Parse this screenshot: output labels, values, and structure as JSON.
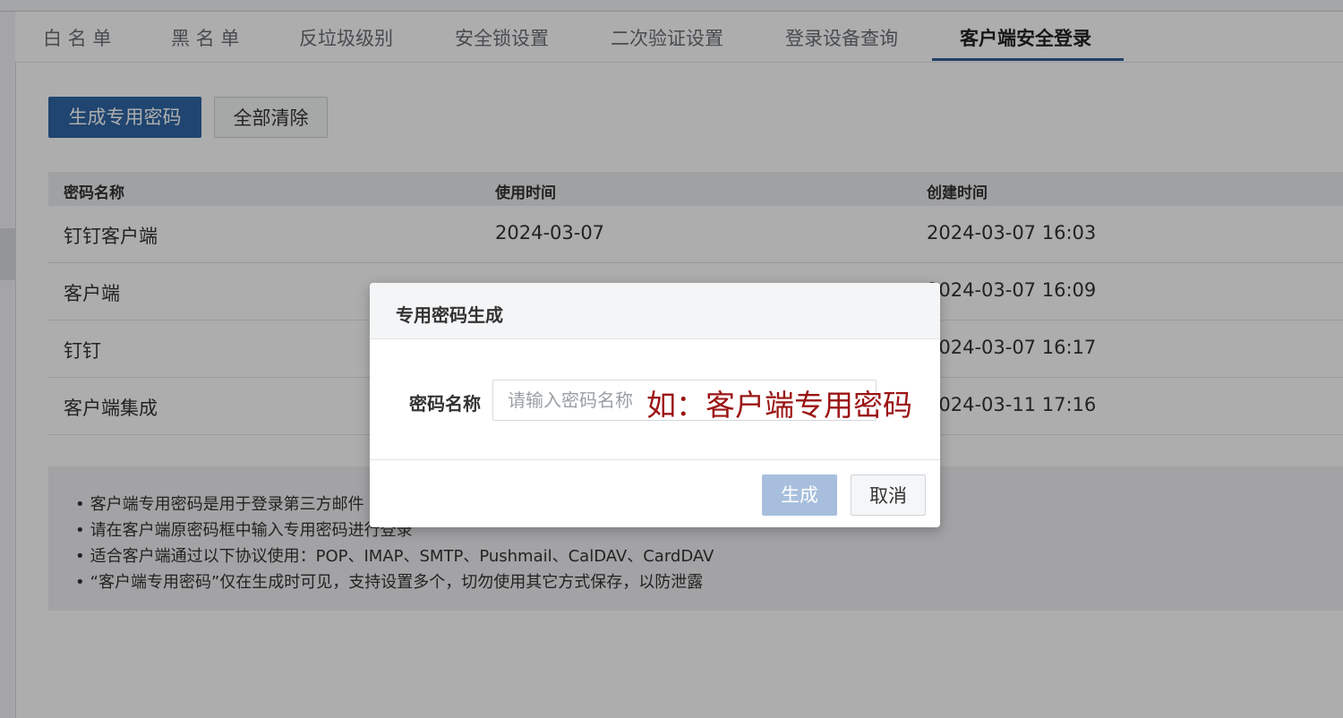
{
  "tabs": [
    {
      "label": "白 名 单"
    },
    {
      "label": "黑 名 单"
    },
    {
      "label": "反垃圾级别"
    },
    {
      "label": "安全锁设置"
    },
    {
      "label": "二次验证设置"
    },
    {
      "label": "登录设备查询"
    },
    {
      "label": "客户端安全登录"
    }
  ],
  "active_tab": "客户端安全登录",
  "toolbar": {
    "generate_label": "生成专用密码",
    "clear_all_label": "全部清除"
  },
  "table": {
    "headers": [
      "密码名称",
      "使用时间",
      "创建时间"
    ],
    "rows": [
      {
        "name": "钉钉客户端",
        "used": "2024-03-07",
        "created": "2024-03-07 16:03"
      },
      {
        "name": "客户端",
        "used": "",
        "created": "2024-03-07 16:09"
      },
      {
        "name": "钉钉",
        "used": "",
        "created": "2024-03-07 16:17"
      },
      {
        "name": "客户端集成",
        "used": "",
        "created": "2024-03-11 17:16"
      }
    ]
  },
  "notes": [
    "客户端专用密码是用于登录第三方邮件",
    "请在客户端原密码框中输入专用密码进行登录",
    "适合客户端通过以下协议使用：POP、IMAP、SMTP、Pushmail、CalDAV、CardDAV",
    "“客户端专用密码”仅在生成时可见，支持设置多个，切勿使用其它方式保存，以防泄露"
  ],
  "modal": {
    "title": "专用密码生成",
    "field_label": "密码名称",
    "placeholder": "请输入密码名称",
    "annotation": "如：客户端专用密码",
    "generate_label": "生成",
    "cancel_label": "取消"
  },
  "colors": {
    "primary": "#2f66a6",
    "primary_disabled": "#a7bfdc",
    "annotation": "#9b1414",
    "tab_underline": "#2f5f95"
  }
}
